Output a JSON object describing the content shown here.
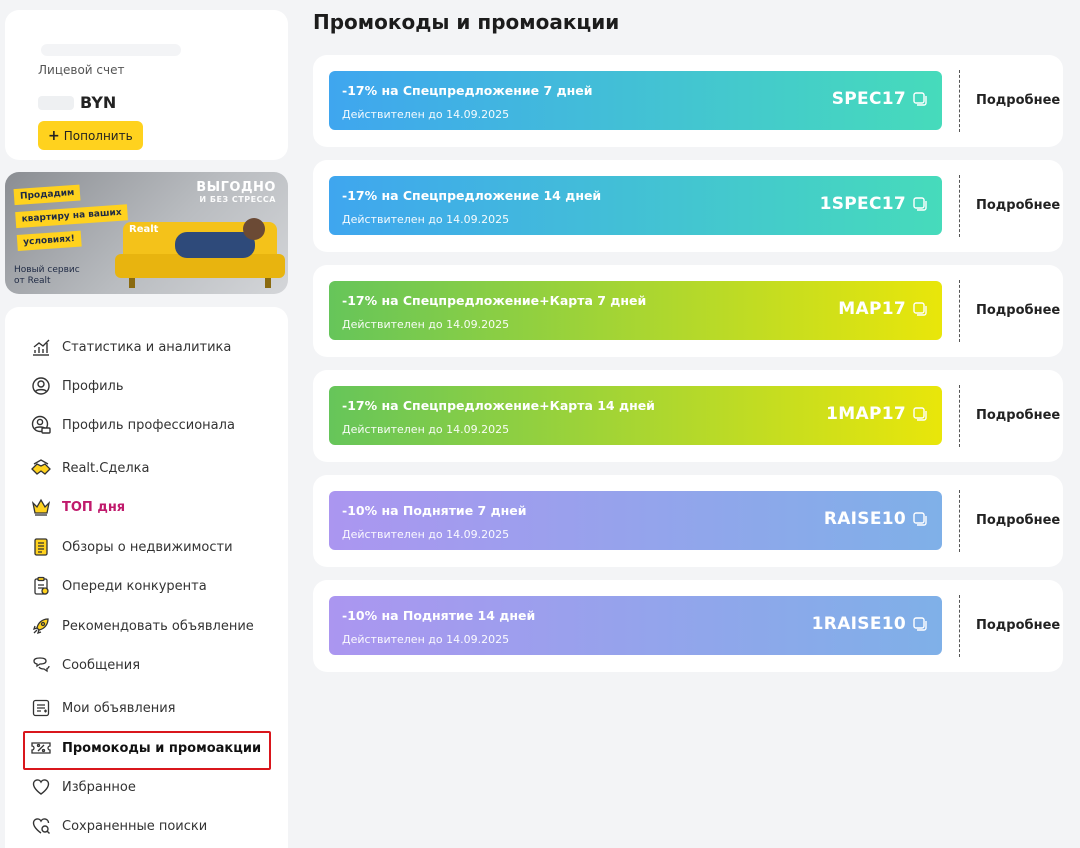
{
  "account": {
    "label": "Лицевой счет",
    "currency": "BYN",
    "topup_label": "Пополнить"
  },
  "banner": {
    "sticker_lines": [
      "Продадим",
      "квартиру на ваших",
      "условиях!"
    ],
    "headline_big": "ВЫГОДНО",
    "headline_small": "И БЕЗ СТРЕССА",
    "brand": "Realt",
    "caption_line1": "Новый сервис",
    "caption_line2": "от Realt"
  },
  "menu": {
    "items": [
      {
        "label": "Статистика и аналитика",
        "icon": "chart-icon"
      },
      {
        "label": "Профиль",
        "icon": "user-icon"
      },
      {
        "label": "Профиль профессионала",
        "icon": "pro-user-icon"
      },
      {
        "label": "Realt.Сделка",
        "icon": "handshake-icon"
      },
      {
        "label": "ТОП дня",
        "icon": "crown-icon"
      },
      {
        "label": "Обзоры о недвижимости",
        "icon": "document-icon"
      },
      {
        "label": "Опереди конкурента",
        "icon": "clipboard-icon"
      },
      {
        "label": "Рекомендовать объявление",
        "icon": "rocket-icon"
      },
      {
        "label": "Сообщения",
        "icon": "chat-icon"
      },
      {
        "label": "Мои объявления",
        "icon": "list-icon"
      },
      {
        "label": "Промокоды и промоакции",
        "icon": "coupon-icon"
      },
      {
        "label": "Избранное",
        "icon": "heart-icon"
      },
      {
        "label": "Сохраненные поиски",
        "icon": "saved-search-icon"
      }
    ],
    "highlight_color": "#c01a6c",
    "active_frame_color": "#d9161c"
  },
  "page": {
    "title": "Промокоды и промоакции"
  },
  "promos": [
    {
      "title": "-17% на Спецпредложение 7 дней",
      "valid": "Действителен до 14.09.2025",
      "code": "SPEC17",
      "more": "Подробнее"
    },
    {
      "title": "-17% на Спецпредложение 14 дней",
      "valid": "Действителен до 14.09.2025",
      "code": "1SPEC17",
      "more": "Подробнее"
    },
    {
      "title": "-17% на Спецпредложение+Карта 7 дней",
      "valid": "Действителен до 14.09.2025",
      "code": "MAP17",
      "more": "Подробнее"
    },
    {
      "title": "-17% на Спецпредложение+Карта 14 дней",
      "valid": "Действителен до 14.09.2025",
      "code": "1MAP17",
      "more": "Подробнее"
    },
    {
      "title": "-10% на Поднятие 7 дней",
      "valid": "Действителен до 14.09.2025",
      "code": "RAISE10",
      "more": "Подробнее"
    },
    {
      "title": "-10% на Поднятие 14 дней",
      "valid": "Действителен до 14.09.2025",
      "code": "1RAISE10",
      "more": "Подробнее"
    }
  ],
  "colors": {
    "accent_yellow": "#ffd21e",
    "blue_gradient": [
      "#3fa6ef",
      "#46dbbb"
    ],
    "green_gradient": [
      "#66c55a",
      "#e9e60a"
    ],
    "violet_gradient": [
      "#ab96f0",
      "#7fb0e8"
    ]
  }
}
